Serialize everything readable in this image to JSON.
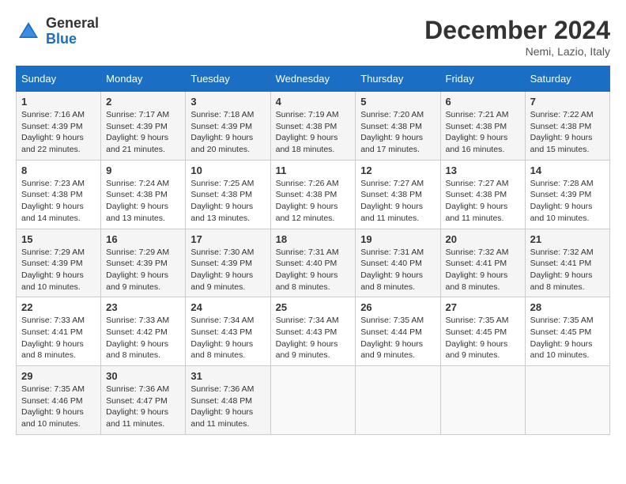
{
  "header": {
    "logo": {
      "general": "General",
      "blue": "Blue"
    },
    "title": "December 2024",
    "location": "Nemi, Lazio, Italy"
  },
  "weekdays": [
    "Sunday",
    "Monday",
    "Tuesday",
    "Wednesday",
    "Thursday",
    "Friday",
    "Saturday"
  ],
  "weeks": [
    [
      {
        "day": "1",
        "sunrise": "7:16 AM",
        "sunset": "4:39 PM",
        "daylight": "9 hours and 22 minutes."
      },
      {
        "day": "2",
        "sunrise": "7:17 AM",
        "sunset": "4:39 PM",
        "daylight": "9 hours and 21 minutes."
      },
      {
        "day": "3",
        "sunrise": "7:18 AM",
        "sunset": "4:39 PM",
        "daylight": "9 hours and 20 minutes."
      },
      {
        "day": "4",
        "sunrise": "7:19 AM",
        "sunset": "4:38 PM",
        "daylight": "9 hours and 18 minutes."
      },
      {
        "day": "5",
        "sunrise": "7:20 AM",
        "sunset": "4:38 PM",
        "daylight": "9 hours and 17 minutes."
      },
      {
        "day": "6",
        "sunrise": "7:21 AM",
        "sunset": "4:38 PM",
        "daylight": "9 hours and 16 minutes."
      },
      {
        "day": "7",
        "sunrise": "7:22 AM",
        "sunset": "4:38 PM",
        "daylight": "9 hours and 15 minutes."
      }
    ],
    [
      {
        "day": "8",
        "sunrise": "7:23 AM",
        "sunset": "4:38 PM",
        "daylight": "9 hours and 14 minutes."
      },
      {
        "day": "9",
        "sunrise": "7:24 AM",
        "sunset": "4:38 PM",
        "daylight": "9 hours and 13 minutes."
      },
      {
        "day": "10",
        "sunrise": "7:25 AM",
        "sunset": "4:38 PM",
        "daylight": "9 hours and 13 minutes."
      },
      {
        "day": "11",
        "sunrise": "7:26 AM",
        "sunset": "4:38 PM",
        "daylight": "9 hours and 12 minutes."
      },
      {
        "day": "12",
        "sunrise": "7:27 AM",
        "sunset": "4:38 PM",
        "daylight": "9 hours and 11 minutes."
      },
      {
        "day": "13",
        "sunrise": "7:27 AM",
        "sunset": "4:38 PM",
        "daylight": "9 hours and 11 minutes."
      },
      {
        "day": "14",
        "sunrise": "7:28 AM",
        "sunset": "4:39 PM",
        "daylight": "9 hours and 10 minutes."
      }
    ],
    [
      {
        "day": "15",
        "sunrise": "7:29 AM",
        "sunset": "4:39 PM",
        "daylight": "9 hours and 10 minutes."
      },
      {
        "day": "16",
        "sunrise": "7:29 AM",
        "sunset": "4:39 PM",
        "daylight": "9 hours and 9 minutes."
      },
      {
        "day": "17",
        "sunrise": "7:30 AM",
        "sunset": "4:39 PM",
        "daylight": "9 hours and 9 minutes."
      },
      {
        "day": "18",
        "sunrise": "7:31 AM",
        "sunset": "4:40 PM",
        "daylight": "9 hours and 8 minutes."
      },
      {
        "day": "19",
        "sunrise": "7:31 AM",
        "sunset": "4:40 PM",
        "daylight": "9 hours and 8 minutes."
      },
      {
        "day": "20",
        "sunrise": "7:32 AM",
        "sunset": "4:41 PM",
        "daylight": "9 hours and 8 minutes."
      },
      {
        "day": "21",
        "sunrise": "7:32 AM",
        "sunset": "4:41 PM",
        "daylight": "9 hours and 8 minutes."
      }
    ],
    [
      {
        "day": "22",
        "sunrise": "7:33 AM",
        "sunset": "4:41 PM",
        "daylight": "9 hours and 8 minutes."
      },
      {
        "day": "23",
        "sunrise": "7:33 AM",
        "sunset": "4:42 PM",
        "daylight": "9 hours and 8 minutes."
      },
      {
        "day": "24",
        "sunrise": "7:34 AM",
        "sunset": "4:43 PM",
        "daylight": "9 hours and 8 minutes."
      },
      {
        "day": "25",
        "sunrise": "7:34 AM",
        "sunset": "4:43 PM",
        "daylight": "9 hours and 9 minutes."
      },
      {
        "day": "26",
        "sunrise": "7:35 AM",
        "sunset": "4:44 PM",
        "daylight": "9 hours and 9 minutes."
      },
      {
        "day": "27",
        "sunrise": "7:35 AM",
        "sunset": "4:45 PM",
        "daylight": "9 hours and 9 minutes."
      },
      {
        "day": "28",
        "sunrise": "7:35 AM",
        "sunset": "4:45 PM",
        "daylight": "9 hours and 10 minutes."
      }
    ],
    [
      {
        "day": "29",
        "sunrise": "7:35 AM",
        "sunset": "4:46 PM",
        "daylight": "9 hours and 10 minutes."
      },
      {
        "day": "30",
        "sunrise": "7:36 AM",
        "sunset": "4:47 PM",
        "daylight": "9 hours and 11 minutes."
      },
      {
        "day": "31",
        "sunrise": "7:36 AM",
        "sunset": "4:48 PM",
        "daylight": "9 hours and 11 minutes."
      },
      null,
      null,
      null,
      null
    ]
  ],
  "labels": {
    "sunrise": "Sunrise:",
    "sunset": "Sunset:",
    "daylight": "Daylight:"
  }
}
